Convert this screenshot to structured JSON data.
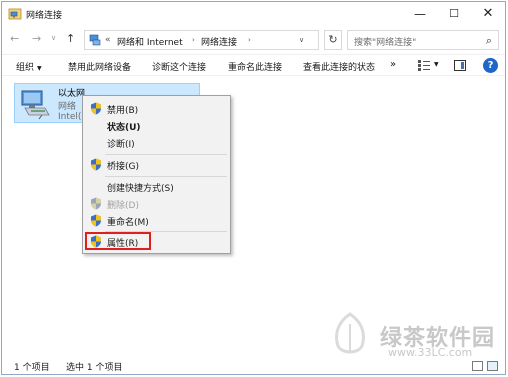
{
  "window": {
    "title": "网络连接",
    "controls": {
      "minimize": "—",
      "maximize": "☐",
      "close": "✕"
    }
  },
  "address_bar": {
    "back": "←",
    "forward": "→",
    "history": "∨",
    "up": "↑",
    "breadcrumb_lead": "«",
    "crumbs": [
      "网络和 Internet",
      "网络连接"
    ],
    "crumb_sep": "›",
    "dropdown": "∨",
    "refresh": "↻",
    "search_placeholder": "搜索\"网络连接\"",
    "search_icon": "⌕"
  },
  "toolbar": {
    "organize": "组织",
    "organize_caret": "▼",
    "actions": [
      "禁用此网络设备",
      "诊断这个连接",
      "重命名此连接",
      "查看此连接的状态"
    ],
    "more": "»",
    "view_dropdown": "▼",
    "help": "?"
  },
  "adapter": {
    "name": "以太网",
    "status": "网络",
    "device": "Intel(R"
  },
  "context_menu": {
    "items": [
      {
        "label": "禁用(B)",
        "shield": true,
        "bold": false,
        "disabled": false
      },
      {
        "label": "状态(U)",
        "shield": false,
        "bold": true,
        "disabled": false
      },
      {
        "label": "诊断(I)",
        "shield": false,
        "bold": false,
        "disabled": false
      },
      {
        "label": "桥接(G)",
        "shield": true,
        "bold": false,
        "disabled": false
      },
      {
        "label": "创建快捷方式(S)",
        "shield": false,
        "bold": false,
        "disabled": false
      },
      {
        "label": "删除(D)",
        "shield": true,
        "bold": false,
        "disabled": true
      },
      {
        "label": "重命名(M)",
        "shield": true,
        "bold": false,
        "disabled": false
      },
      {
        "label": "属性(R)",
        "shield": true,
        "bold": false,
        "disabled": false,
        "highlighted": true
      }
    ]
  },
  "status_bar": {
    "item_count": "1 个项目",
    "selected": "选中 1 个项目"
  },
  "watermark": {
    "brand": "绿茶软件园",
    "url": "www.33LC.com"
  },
  "colors": {
    "selection_fill": "#cce8ff",
    "highlight_box": "#e0201c",
    "help_icon": "#1e66c8"
  }
}
